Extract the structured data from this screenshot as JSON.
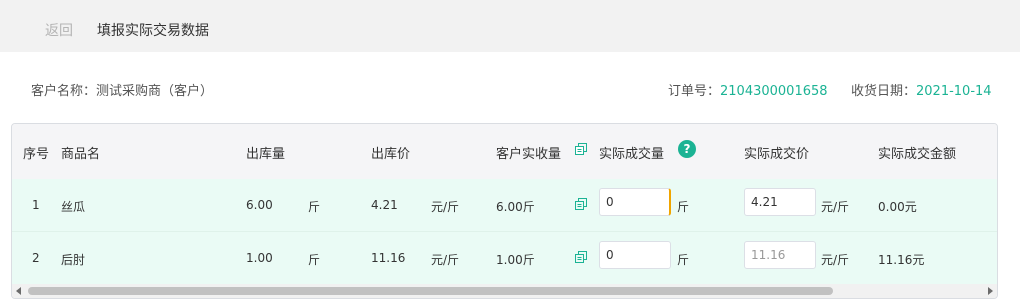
{
  "header": {
    "back_label": "返回",
    "title": "填报实际交易数据"
  },
  "info": {
    "customer_label": "客户名称：",
    "customer_value": "测试采购商（客户）",
    "order_label": "订单号：",
    "order_value": "2104300001658",
    "date_label": "收货日期：",
    "date_value": "2021-10-14"
  },
  "table": {
    "columns": [
      "序号",
      "商品名",
      "出库量",
      "出库价",
      "客户实收量",
      "实际成交量",
      "实际成交价",
      "实际成交金额"
    ],
    "rows": [
      {
        "index": "1",
        "name": "丝瓜",
        "out_qty": "6.00",
        "out_qty_unit": "斤",
        "out_price": "4.21",
        "out_price_unit": "元/斤",
        "received": "6.00斤",
        "actual_qty": "0",
        "actual_qty_unit": "斤",
        "actual_price": "4.21",
        "actual_price_unit": "元/斤",
        "amount": "0.00元"
      },
      {
        "index": "2",
        "name": "后肘",
        "out_qty": "1.00",
        "out_qty_unit": "斤",
        "out_price": "11.16",
        "out_price_unit": "元/斤",
        "received": "1.00斤",
        "actual_qty": "0",
        "actual_qty_unit": "斤",
        "actual_price": "11.16",
        "actual_price_unit": "元/斤",
        "amount": "11.16元"
      }
    ]
  },
  "help_icon_glyph": "?",
  "colors": {
    "accent": "#1bb394",
    "row_bg": "#eafbf5",
    "active_border": "#f0a500"
  }
}
